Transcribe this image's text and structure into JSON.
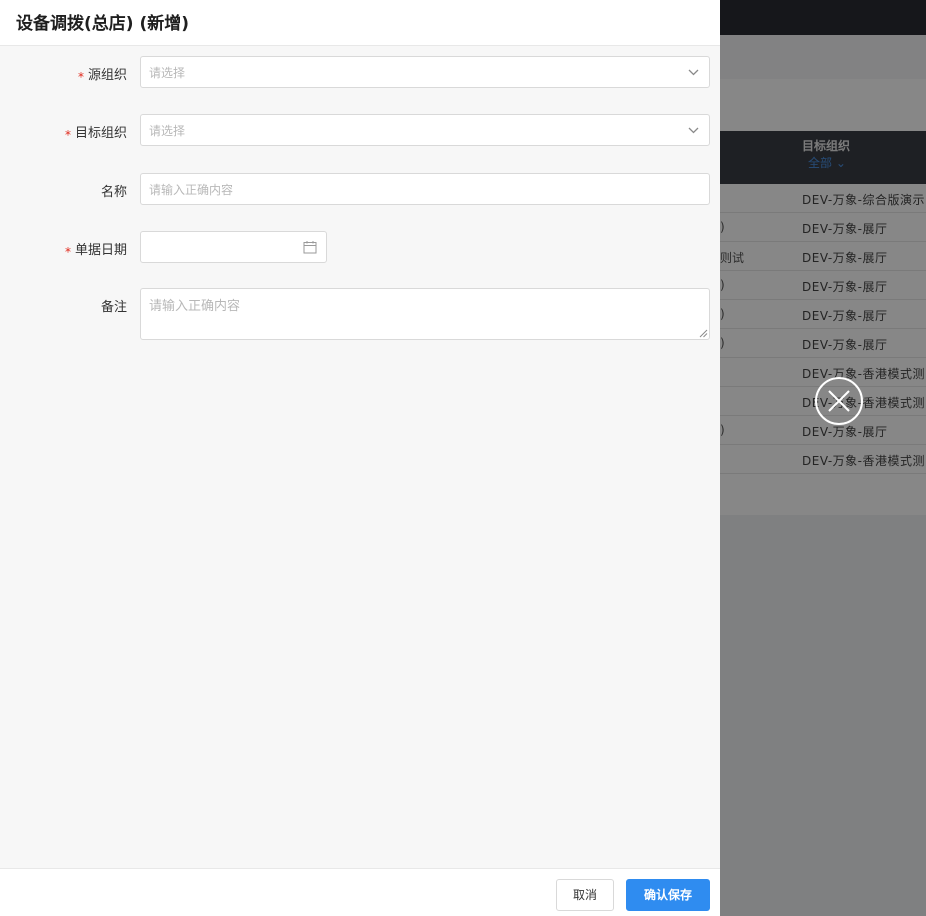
{
  "drawer": {
    "title": "设备调拨(总店) (新增)",
    "fields": {
      "source_org": {
        "label": "源组织",
        "required": "*",
        "placeholder": "请选择"
      },
      "target_org": {
        "label": "目标组织",
        "required": "*",
        "placeholder": "请选择"
      },
      "name": {
        "label": "名称",
        "placeholder": "请输入正确内容"
      },
      "doc_date": {
        "label": "单据日期",
        "required": "*",
        "value": ""
      },
      "remark": {
        "label": "备注",
        "placeholder": "请输入正确内容"
      }
    },
    "footer": {
      "cancel_label": "取消",
      "confirm_label": "确认保存"
    }
  },
  "background_table": {
    "column_header": "目标组织",
    "filter_label": "全部 ⌄",
    "rows": [
      {
        "left": "",
        "target": "DEV-万象-综合版演示"
      },
      {
        "left": ")",
        "target": "DEV-万象-展厅"
      },
      {
        "left": "则试",
        "target": "DEV-万象-展厅"
      },
      {
        "left": ")",
        "target": "DEV-万象-展厅"
      },
      {
        "left": ")",
        "target": "DEV-万象-展厅"
      },
      {
        "left": ")",
        "target": "DEV-万象-展厅"
      },
      {
        "left": "",
        "target": "DEV-万象-香港模式测"
      },
      {
        "left": "",
        "target": "DEV-万象-香港模式测"
      },
      {
        "left": ")",
        "target": "DEV-万象-展厅"
      },
      {
        "left": "",
        "target": "DEV-万象-香港模式测"
      }
    ]
  },
  "colors": {
    "primary": "#2f8cf0",
    "required": "#e0281b",
    "overlay": "rgba(0,0,0,0.47)"
  }
}
